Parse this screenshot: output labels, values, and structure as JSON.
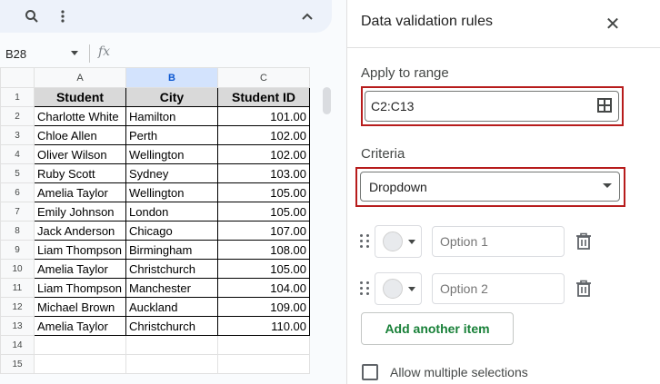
{
  "toolbar": {
    "icons": [
      "search-icon",
      "more-vert-icon",
      "chevron-up-icon"
    ]
  },
  "formula_bar": {
    "cell_ref": "B28",
    "fx_label": "fx"
  },
  "sheet": {
    "row_numbers": [
      "1",
      "2",
      "3",
      "4",
      "5",
      "6",
      "7",
      "8",
      "9",
      "10",
      "11",
      "12",
      "13",
      "14",
      "15"
    ],
    "column_headers": [
      "A",
      "B",
      "C"
    ],
    "selected_column": "B",
    "headers": [
      "Student",
      "City",
      "Student ID"
    ],
    "rows": [
      [
        "Charlotte White",
        "Hamilton",
        "101.00"
      ],
      [
        "Chloe Allen",
        "Perth",
        "102.00"
      ],
      [
        "Oliver Wilson",
        "Wellington",
        "102.00"
      ],
      [
        "Ruby Scott",
        "Sydney",
        "103.00"
      ],
      [
        "Amelia Taylor",
        "Wellington",
        "105.00"
      ],
      [
        "Emily Johnson",
        "London",
        "105.00"
      ],
      [
        "Jack Anderson",
        "Chicago",
        "107.00"
      ],
      [
        "Liam Thompson",
        "Birmingham",
        "108.00"
      ],
      [
        "Amelia Taylor",
        "Christchurch",
        "105.00"
      ],
      [
        "Liam Thompson",
        "Manchester",
        "104.00"
      ],
      [
        "Michael Brown",
        "Auckland",
        "109.00"
      ],
      [
        "Amelia Taylor",
        "Christchurch",
        "110.00"
      ]
    ]
  },
  "panel": {
    "title": "Data validation rules",
    "apply_label": "Apply to range",
    "range_value": "C2:C13",
    "criteria_label": "Criteria",
    "criteria_value": "Dropdown",
    "options": [
      {
        "placeholder": "Option 1"
      },
      {
        "placeholder": "Option 2"
      }
    ],
    "add_item_label": "Add another item",
    "allow_multiple_label": "Allow multiple selections"
  },
  "colors": {
    "highlight_border": "#b71c1c",
    "add_button_text": "#188038",
    "selected_column_bg": "#d3e3fd"
  }
}
